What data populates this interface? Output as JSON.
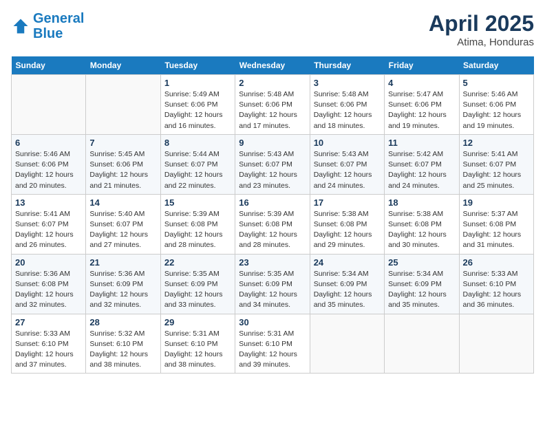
{
  "header": {
    "logo_line1": "General",
    "logo_line2": "Blue",
    "title": "April 2025",
    "subtitle": "Atima, Honduras"
  },
  "days_of_week": [
    "Sunday",
    "Monday",
    "Tuesday",
    "Wednesday",
    "Thursday",
    "Friday",
    "Saturday"
  ],
  "weeks": [
    [
      {
        "day": "",
        "info": ""
      },
      {
        "day": "",
        "info": ""
      },
      {
        "day": "1",
        "info": "Sunrise: 5:49 AM\nSunset: 6:06 PM\nDaylight: 12 hours and 16 minutes."
      },
      {
        "day": "2",
        "info": "Sunrise: 5:48 AM\nSunset: 6:06 PM\nDaylight: 12 hours and 17 minutes."
      },
      {
        "day": "3",
        "info": "Sunrise: 5:48 AM\nSunset: 6:06 PM\nDaylight: 12 hours and 18 minutes."
      },
      {
        "day": "4",
        "info": "Sunrise: 5:47 AM\nSunset: 6:06 PM\nDaylight: 12 hours and 19 minutes."
      },
      {
        "day": "5",
        "info": "Sunrise: 5:46 AM\nSunset: 6:06 PM\nDaylight: 12 hours and 19 minutes."
      }
    ],
    [
      {
        "day": "6",
        "info": "Sunrise: 5:46 AM\nSunset: 6:06 PM\nDaylight: 12 hours and 20 minutes."
      },
      {
        "day": "7",
        "info": "Sunrise: 5:45 AM\nSunset: 6:06 PM\nDaylight: 12 hours and 21 minutes."
      },
      {
        "day": "8",
        "info": "Sunrise: 5:44 AM\nSunset: 6:07 PM\nDaylight: 12 hours and 22 minutes."
      },
      {
        "day": "9",
        "info": "Sunrise: 5:43 AM\nSunset: 6:07 PM\nDaylight: 12 hours and 23 minutes."
      },
      {
        "day": "10",
        "info": "Sunrise: 5:43 AM\nSunset: 6:07 PM\nDaylight: 12 hours and 24 minutes."
      },
      {
        "day": "11",
        "info": "Sunrise: 5:42 AM\nSunset: 6:07 PM\nDaylight: 12 hours and 24 minutes."
      },
      {
        "day": "12",
        "info": "Sunrise: 5:41 AM\nSunset: 6:07 PM\nDaylight: 12 hours and 25 minutes."
      }
    ],
    [
      {
        "day": "13",
        "info": "Sunrise: 5:41 AM\nSunset: 6:07 PM\nDaylight: 12 hours and 26 minutes."
      },
      {
        "day": "14",
        "info": "Sunrise: 5:40 AM\nSunset: 6:07 PM\nDaylight: 12 hours and 27 minutes."
      },
      {
        "day": "15",
        "info": "Sunrise: 5:39 AM\nSunset: 6:08 PM\nDaylight: 12 hours and 28 minutes."
      },
      {
        "day": "16",
        "info": "Sunrise: 5:39 AM\nSunset: 6:08 PM\nDaylight: 12 hours and 28 minutes."
      },
      {
        "day": "17",
        "info": "Sunrise: 5:38 AM\nSunset: 6:08 PM\nDaylight: 12 hours and 29 minutes."
      },
      {
        "day": "18",
        "info": "Sunrise: 5:38 AM\nSunset: 6:08 PM\nDaylight: 12 hours and 30 minutes."
      },
      {
        "day": "19",
        "info": "Sunrise: 5:37 AM\nSunset: 6:08 PM\nDaylight: 12 hours and 31 minutes."
      }
    ],
    [
      {
        "day": "20",
        "info": "Sunrise: 5:36 AM\nSunset: 6:08 PM\nDaylight: 12 hours and 32 minutes."
      },
      {
        "day": "21",
        "info": "Sunrise: 5:36 AM\nSunset: 6:09 PM\nDaylight: 12 hours and 32 minutes."
      },
      {
        "day": "22",
        "info": "Sunrise: 5:35 AM\nSunset: 6:09 PM\nDaylight: 12 hours and 33 minutes."
      },
      {
        "day": "23",
        "info": "Sunrise: 5:35 AM\nSunset: 6:09 PM\nDaylight: 12 hours and 34 minutes."
      },
      {
        "day": "24",
        "info": "Sunrise: 5:34 AM\nSunset: 6:09 PM\nDaylight: 12 hours and 35 minutes."
      },
      {
        "day": "25",
        "info": "Sunrise: 5:34 AM\nSunset: 6:09 PM\nDaylight: 12 hours and 35 minutes."
      },
      {
        "day": "26",
        "info": "Sunrise: 5:33 AM\nSunset: 6:10 PM\nDaylight: 12 hours and 36 minutes."
      }
    ],
    [
      {
        "day": "27",
        "info": "Sunrise: 5:33 AM\nSunset: 6:10 PM\nDaylight: 12 hours and 37 minutes."
      },
      {
        "day": "28",
        "info": "Sunrise: 5:32 AM\nSunset: 6:10 PM\nDaylight: 12 hours and 38 minutes."
      },
      {
        "day": "29",
        "info": "Sunrise: 5:31 AM\nSunset: 6:10 PM\nDaylight: 12 hours and 38 minutes."
      },
      {
        "day": "30",
        "info": "Sunrise: 5:31 AM\nSunset: 6:10 PM\nDaylight: 12 hours and 39 minutes."
      },
      {
        "day": "",
        "info": ""
      },
      {
        "day": "",
        "info": ""
      },
      {
        "day": "",
        "info": ""
      }
    ]
  ]
}
